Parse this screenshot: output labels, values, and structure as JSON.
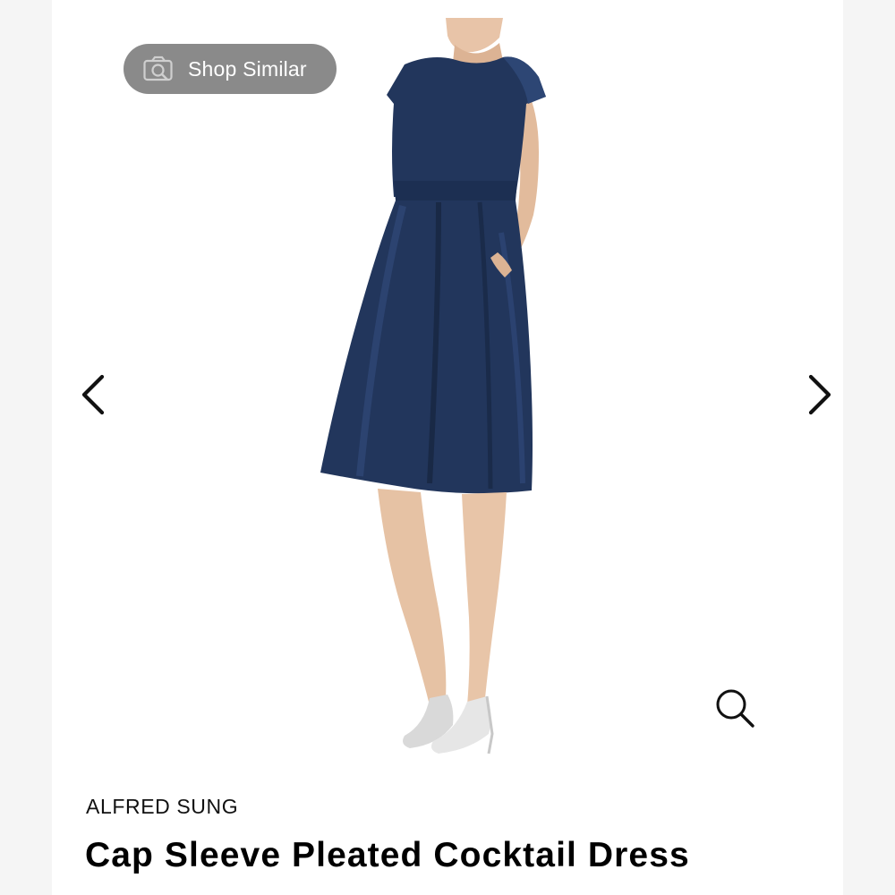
{
  "gallery": {
    "shop_similar_label": "Shop Similar",
    "icons": {
      "shop_similar": "camera-search-icon",
      "previous": "chevron-left-icon",
      "next": "chevron-right-icon",
      "zoom": "magnifier-icon"
    }
  },
  "product": {
    "brand": "ALFRED SUNG",
    "title": "Cap Sleeve Pleated Cocktail Dress",
    "dress_color": "#1f3458"
  }
}
